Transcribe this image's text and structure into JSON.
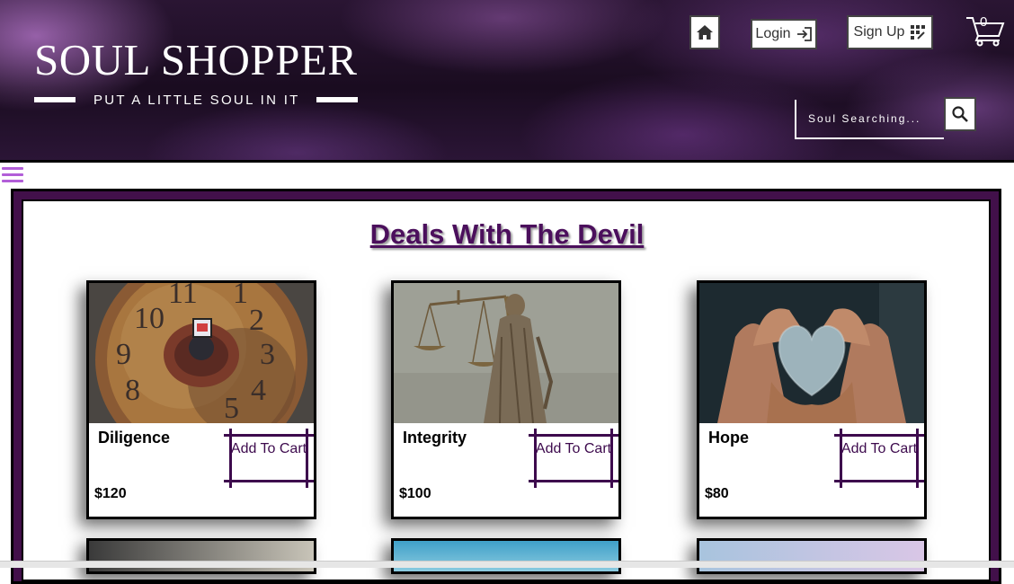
{
  "brand": {
    "title": "SOUL SHOPPER",
    "tagline": "PUT A LITTLE SOUL IN IT"
  },
  "nav": {
    "home_icon": "home-icon",
    "login_label": "Login",
    "signup_label": "Sign Up",
    "cart_count": "0"
  },
  "search": {
    "placeholder": "Soul Searching..."
  },
  "section": {
    "title": "Deals With The Devil"
  },
  "products": [
    {
      "name": "Diligence",
      "price": "$120",
      "button": "Add To Cart",
      "image": "clock-with-person-image"
    },
    {
      "name": "Integrity",
      "price": "$100",
      "button": "Add To Cart",
      "image": "lady-justice-statue-image"
    },
    {
      "name": "Hope",
      "price": "$80",
      "button": "Add To Cart",
      "image": "hands-holding-heart-stone-image"
    }
  ],
  "colors": {
    "accent": "#4b0f5c",
    "panel_border": "#42104a",
    "menu": "#b25ed8"
  }
}
